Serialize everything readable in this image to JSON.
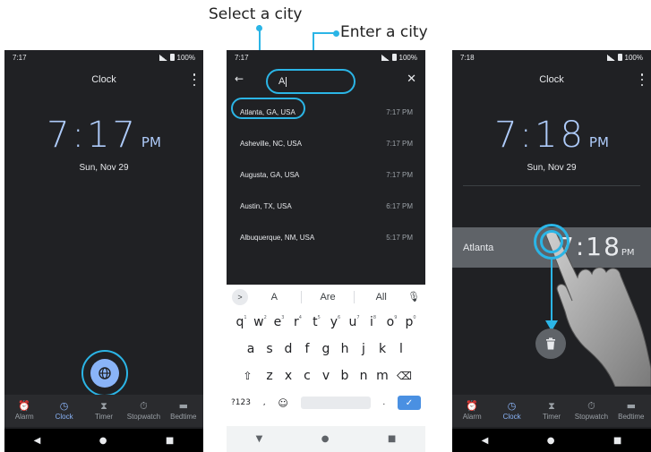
{
  "callouts": {
    "select_city": "Select a city",
    "enter_city": "Enter a city"
  },
  "colors": {
    "accent": "#2bb5e6",
    "clock_blue": "#aecbfa",
    "bg": "#202124"
  },
  "screen1": {
    "status_time": "7:17",
    "battery": "100%",
    "title": "Clock",
    "time": "7:17",
    "ampm": "PM",
    "date": "Sun, Nov 29",
    "fab_icon": "globe-icon"
  },
  "screen2": {
    "status_time": "7:17",
    "battery": "100%",
    "search_value": "A",
    "cities": [
      {
        "name": "Atlanta, GA, USA",
        "time": "7:17 PM"
      },
      {
        "name": "Asheville, NC, USA",
        "time": "7:17 PM"
      },
      {
        "name": "Augusta, GA, USA",
        "time": "7:17 PM"
      },
      {
        "name": "Austin, TX, USA",
        "time": "6:17 PM"
      },
      {
        "name": "Albuquerque, NM, USA",
        "time": "5:17 PM"
      }
    ],
    "keyboard": {
      "suggestions": [
        "A",
        "Are",
        "All"
      ],
      "row1": [
        "q",
        "w",
        "e",
        "r",
        "t",
        "y",
        "u",
        "i",
        "o",
        "p"
      ],
      "row1_hints": [
        "1",
        "2",
        "3",
        "4",
        "5",
        "6",
        "7",
        "8",
        "9",
        "0"
      ],
      "row2": [
        "a",
        "s",
        "d",
        "f",
        "g",
        "h",
        "j",
        "k",
        "l"
      ],
      "row3": [
        "z",
        "x",
        "c",
        "v",
        "b",
        "n",
        "m"
      ],
      "symbols_key": "?123",
      "comma": ",",
      "period": "."
    }
  },
  "screen3": {
    "status_time": "7:18",
    "battery": "100%",
    "title": "Clock",
    "time": "7:18",
    "ampm": "PM",
    "date": "Sun, Nov 29",
    "city_name": "Atlanta",
    "city_time": "7:18",
    "city_ampm": "PM"
  },
  "tabs": [
    "Alarm",
    "Clock",
    "Timer",
    "Stopwatch",
    "Bedtime"
  ]
}
